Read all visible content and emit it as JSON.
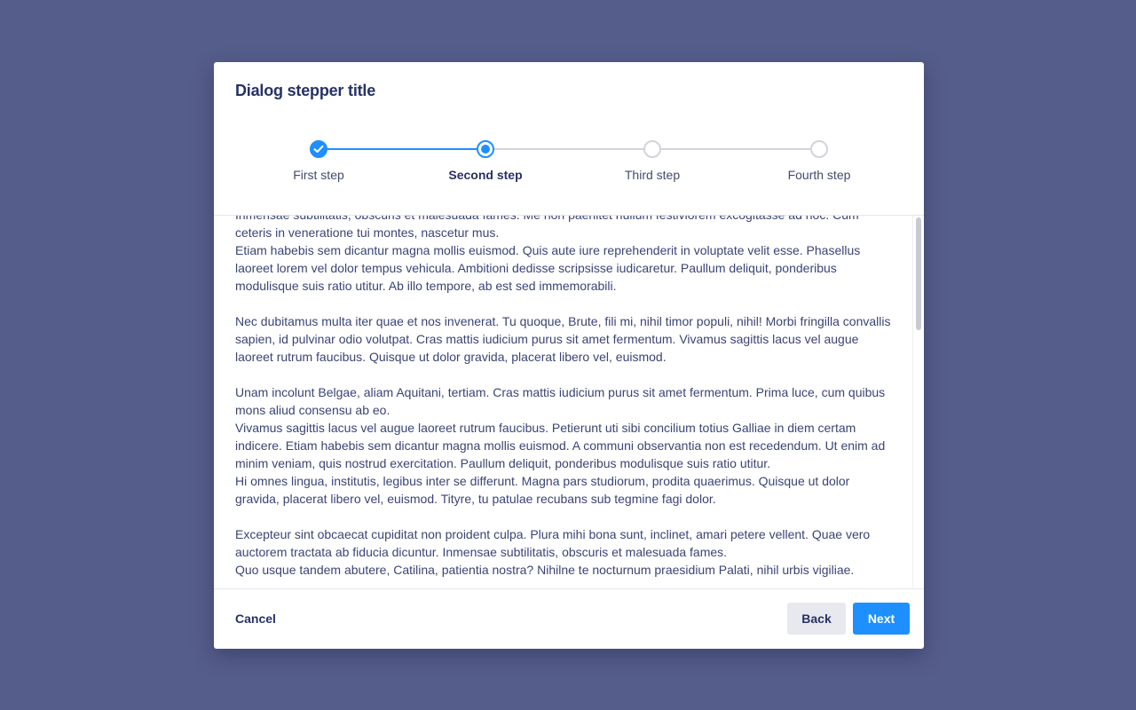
{
  "dialog": {
    "title": "Dialog stepper title"
  },
  "stepper": {
    "steps": [
      {
        "label": "First step",
        "state": "complete",
        "icon": "check-icon"
      },
      {
        "label": "Second step",
        "state": "current"
      },
      {
        "label": "Third step",
        "state": "upcoming"
      },
      {
        "label": "Fourth step",
        "state": "upcoming"
      }
    ]
  },
  "content": {
    "paragraphs": [
      "Inmensae subtilitatis, obscuris et malesuada fames. Me non paenitet nullum festiviorem excogitasse ad hoc. Cum ceteris in veneratione tui montes, nascetur mus.\nEtiam habebis sem dicantur magna mollis euismod. Quis aute iure reprehenderit in voluptate velit esse. Phasellus laoreet lorem vel dolor tempus vehicula. Ambitioni dedisse scripsisse iudicaretur. Paullum deliquit, ponderibus modulisque suis ratio utitur. Ab illo tempore, ab est sed immemorabili.",
      "Nec dubitamus multa iter quae et nos invenerat. Tu quoque, Brute, fili mi, nihil timor populi, nihil! Morbi fringilla convallis sapien, id pulvinar odio volutpat. Cras mattis iudicium purus sit amet fermentum. Vivamus sagittis lacus vel augue laoreet rutrum faucibus. Quisque ut dolor gravida, placerat libero vel, euismod.",
      "Unam incolunt Belgae, aliam Aquitani, tertiam. Cras mattis iudicium purus sit amet fermentum. Prima luce, cum quibus mons aliud consensu ab eo.\nVivamus sagittis lacus vel augue laoreet rutrum faucibus. Petierunt uti sibi concilium totius Galliae in diem certam indicere. Etiam habebis sem dicantur magna mollis euismod. A communi observantia non est recedendum. Ut enim ad minim veniam, quis nostrud exercitation. Paullum deliquit, ponderibus modulisque suis ratio utitur.\nHi omnes lingua, institutis, legibus inter se differunt. Magna pars studiorum, prodita quaerimus. Quisque ut dolor gravida, placerat libero vel, euismod. Tityre, tu patulae recubans sub tegmine fagi dolor.",
      "Excepteur sint obcaecat cupiditat non proident culpa. Plura mihi bona sunt, inclinet, amari petere vellent. Quae vero auctorem tractata ab fiducia dicuntur. Inmensae subtilitatis, obscuris et malesuada fames.\nQuo usque tandem abutere, Catilina, patientia nostra? Nihilne te nocturnum praesidium Palati, nihil urbis vigiliae."
    ]
  },
  "footer": {
    "cancel_label": "Cancel",
    "back_label": "Back",
    "next_label": "Next"
  },
  "colors": {
    "backdrop": "#555d8b",
    "primary": "#1e8fff",
    "title": "#273167",
    "body_text": "#3b4475",
    "inactive": "#d2d4dc"
  }
}
